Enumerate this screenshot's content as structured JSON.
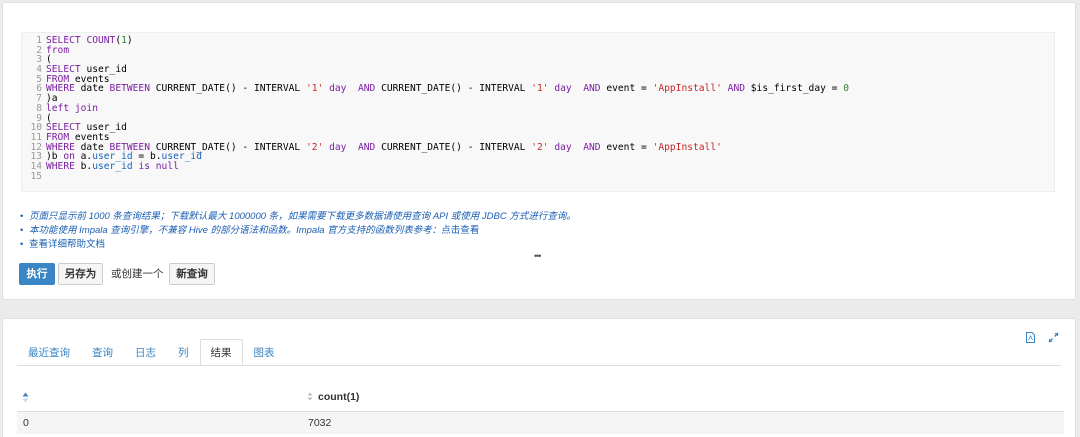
{
  "editor": {
    "lines": [
      {
        "n": "1",
        "t": [
          [
            "kw",
            "SELECT "
          ],
          [
            "fn",
            "COUNT"
          ],
          [
            "code",
            "("
          ],
          [
            "num",
            "1"
          ],
          [
            "code",
            ")"
          ]
        ]
      },
      {
        "n": "2",
        "t": [
          [
            "kw",
            "from"
          ]
        ]
      },
      {
        "n": "3",
        "t": [
          [
            "code",
            "("
          ]
        ]
      },
      {
        "n": "4",
        "t": [
          [
            "kw",
            "SELECT "
          ],
          [
            "code",
            "user_id"
          ]
        ]
      },
      {
        "n": "5",
        "t": [
          [
            "kw",
            "FROM "
          ],
          [
            "code",
            "events"
          ]
        ]
      },
      {
        "n": "6",
        "t": [
          [
            "kw",
            "WHERE "
          ],
          [
            "code",
            "date "
          ],
          [
            "kw",
            "BETWEEN "
          ],
          [
            "code",
            "CURRENT_DATE() - INTERVAL "
          ],
          [
            "str",
            "'1'"
          ],
          [
            "code",
            " "
          ],
          [
            "kw",
            "day"
          ],
          [
            "code",
            "  "
          ],
          [
            "kw",
            "AND "
          ],
          [
            "code",
            "CURRENT_DATE() - INTERVAL "
          ],
          [
            "str",
            "'1'"
          ],
          [
            "code",
            " "
          ],
          [
            "kw",
            "day"
          ],
          [
            "code",
            "  "
          ],
          [
            "kw",
            "AND "
          ],
          [
            "code",
            "event = "
          ],
          [
            "str",
            "'AppInstall'"
          ],
          [
            "code",
            " "
          ],
          [
            "kw",
            "AND "
          ],
          [
            "code",
            "$is_first_day = "
          ],
          [
            "num",
            "0"
          ]
        ]
      },
      {
        "n": "7",
        "t": [
          [
            "code",
            ")a"
          ]
        ]
      },
      {
        "n": "8",
        "t": [
          [
            "kw",
            "left join"
          ]
        ]
      },
      {
        "n": "9",
        "t": [
          [
            "code",
            "("
          ]
        ]
      },
      {
        "n": "10",
        "t": [
          [
            "kw",
            "SELECT "
          ],
          [
            "code",
            "user_id"
          ]
        ]
      },
      {
        "n": "11",
        "t": [
          [
            "kw",
            "FROM "
          ],
          [
            "code",
            "events"
          ]
        ]
      },
      {
        "n": "12",
        "t": [
          [
            "kw",
            "WHERE "
          ],
          [
            "code",
            "date "
          ],
          [
            "kw",
            "BETWEEN "
          ],
          [
            "code",
            "CURRENT_DATE() - INTERVAL "
          ],
          [
            "str",
            "'2'"
          ],
          [
            "code",
            " "
          ],
          [
            "kw",
            "day"
          ],
          [
            "code",
            "  "
          ],
          [
            "kw",
            "AND "
          ],
          [
            "code",
            "CURRENT_DATE() - INTERVAL "
          ],
          [
            "str",
            "'2'"
          ],
          [
            "code",
            " "
          ],
          [
            "kw",
            "day"
          ],
          [
            "code",
            "  "
          ],
          [
            "kw",
            "AND "
          ],
          [
            "code",
            "event = "
          ],
          [
            "str",
            "'AppInstall'"
          ]
        ]
      },
      {
        "n": "13",
        "t": [
          [
            "code",
            ")b "
          ],
          [
            "kw",
            "on "
          ],
          [
            "code",
            "a."
          ],
          [
            "id",
            "user_id"
          ],
          [
            "code",
            " = b."
          ],
          [
            "id",
            "user_id"
          ]
        ]
      },
      {
        "n": "14",
        "t": [
          [
            "kw",
            "WHERE "
          ],
          [
            "code",
            "b."
          ],
          [
            "id",
            "user_id"
          ],
          [
            "code",
            " "
          ],
          [
            "kw",
            "is null"
          ]
        ]
      },
      {
        "n": "15",
        "t": []
      }
    ]
  },
  "notes": {
    "note1": "页面只显示前 1000 条查询结果；下载默认最大 1000000 条，如果需要下载更多数据请使用查询 API 或使用 JDBC 方式进行查询。",
    "note2_prefix": "本功能使用 Impala 查询引擎，不兼容 Hive 的部分语法和函数。Impala 官方支持的函数列表参考：",
    "note2_link": "点击查看",
    "note3": "查看详细帮助文档",
    "ellipsis": "•••"
  },
  "actions": {
    "run_label": "执行",
    "save_as_label": "另存为",
    "or_create_text": "或创建一个",
    "new_query_label": "新查询"
  },
  "tabs": [
    {
      "label": "最近查询",
      "active": false
    },
    {
      "label": "查询",
      "active": false
    },
    {
      "label": "日志",
      "active": false
    },
    {
      "label": "列",
      "active": false
    },
    {
      "label": "结果",
      "active": true
    },
    {
      "label": "图表",
      "active": false
    }
  ],
  "results": {
    "columns": [
      "",
      "count(1)"
    ],
    "rows": [
      [
        "0",
        "7032"
      ]
    ]
  },
  "colors": {
    "accent": "#3a85c3",
    "note_blue": "#1a5fb4"
  }
}
